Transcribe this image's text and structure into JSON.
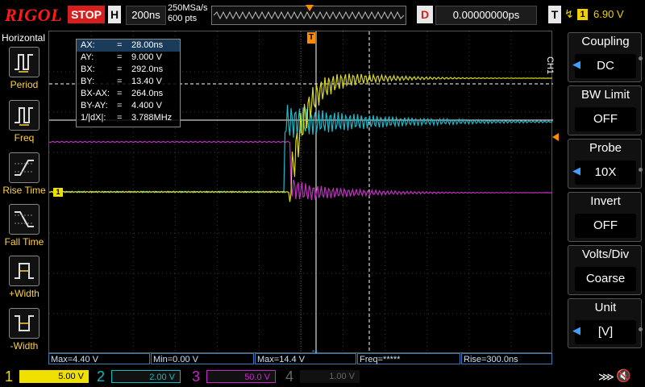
{
  "header": {
    "logo": "RIGOL",
    "run_state": "STOP",
    "horizontal_label": "H",
    "timebase": "200ns",
    "sample_rate": "250MSa/s",
    "memory_depth": "600 pts",
    "delay_label": "D",
    "delay_value": "0.00000000ps",
    "trigger_label": "T",
    "trigger_source": "1",
    "trigger_level": "6.90 V"
  },
  "left_menu": {
    "title": "Horizontal",
    "items": [
      {
        "label": "Period",
        "icon": "period-icon"
      },
      {
        "label": "Freq",
        "icon": "freq-icon"
      },
      {
        "label": "Rise Time",
        "icon": "rise-time-icon"
      },
      {
        "label": "Fall Time",
        "icon": "fall-time-icon"
      },
      {
        "label": "+Width",
        "icon": "positive-width-icon"
      },
      {
        "label": "-Width",
        "icon": "negative-width-icon"
      }
    ]
  },
  "cursor_readout": {
    "rows": [
      {
        "key": "AX:",
        "value": "28.00ns"
      },
      {
        "key": "AY:",
        "value": "9.000 V"
      },
      {
        "key": "BX:",
        "value": "292.0ns"
      },
      {
        "key": "BY:",
        "value": "13.40 V"
      },
      {
        "key": "BX-AX:",
        "value": "264.0ns"
      },
      {
        "key": "BY-AY:",
        "value": "4.400 V"
      },
      {
        "key": "1/|dX|:",
        "value": "3.788MHz"
      }
    ]
  },
  "right_menu": {
    "channel_tag": "CH1",
    "items": [
      {
        "title": "Coupling",
        "value": "DC"
      },
      {
        "title": "BW Limit",
        "value": "OFF"
      },
      {
        "title": "Probe",
        "value": "10X"
      },
      {
        "title": "Invert",
        "value": "OFF"
      },
      {
        "title": "Volts/Div",
        "value": "Coarse"
      },
      {
        "title": "Unit",
        "value": "[V]"
      }
    ]
  },
  "measurements": [
    "Max=4.40 V",
    "Min=0.00 V",
    "Max=14.4 V",
    "Freq=*****",
    "Rise=300.0ns"
  ],
  "channels": [
    {
      "num": "1",
      "scale": "5.00 V",
      "color": "#f0e000"
    },
    {
      "num": "2",
      "scale": "2.00 V",
      "color": "#00c0c0"
    },
    {
      "num": "3",
      "scale": "50.0 V",
      "color": "#d020d0"
    },
    {
      "num": "4",
      "scale": "1.00 V",
      "color": "#3050ff"
    }
  ],
  "colors": {
    "ch1": "#d8d820",
    "ch2": "#20b8c8",
    "ch3": "#c030c0",
    "accent_blue": "#3fa0ff",
    "trigger_orange": "#ff8c00"
  }
}
